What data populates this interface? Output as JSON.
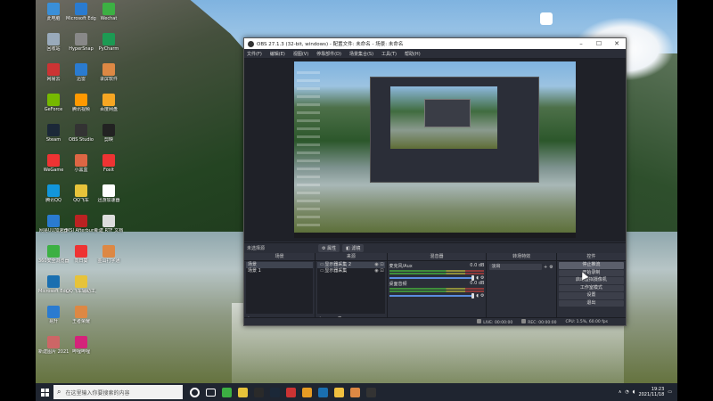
{
  "desktop_icons": [
    {
      "label": "此电脑",
      "color": "#3a8fd8",
      "col": 0,
      "row": 0
    },
    {
      "label": "Microsoft Edge",
      "color": "#2a7bd0",
      "col": 1,
      "row": 0
    },
    {
      "label": "Wechat",
      "color": "#3cb043",
      "col": 2,
      "row": 0
    },
    {
      "label": "回收站",
      "color": "#9ab",
      "col": 0,
      "row": 1
    },
    {
      "label": "HyperSnap",
      "color": "#888",
      "col": 1,
      "row": 1
    },
    {
      "label": "PyCharm",
      "color": "#1c9a53",
      "col": 2,
      "row": 1
    },
    {
      "label": "网易云",
      "color": "#c33",
      "col": 0,
      "row": 2
    },
    {
      "label": "迅雷",
      "color": "#2a7bd0",
      "col": 1,
      "row": 2
    },
    {
      "label": "录屏软件",
      "color": "#d84",
      "col": 2,
      "row": 2
    },
    {
      "label": "GeForce",
      "color": "#76b900",
      "col": 0,
      "row": 3
    },
    {
      "label": "腾讯视频",
      "color": "#f90",
      "col": 1,
      "row": 3
    },
    {
      "label": "百度网盘",
      "color": "#f6a623",
      "col": 2,
      "row": 3
    },
    {
      "label": "Steam",
      "color": "#1b2838",
      "col": 0,
      "row": 4
    },
    {
      "label": "OBS Studio",
      "color": "#333",
      "col": 1,
      "row": 4
    },
    {
      "label": "剪映",
      "color": "#222",
      "col": 2,
      "row": 4
    },
    {
      "label": "WeGame",
      "color": "#e33",
      "col": 0,
      "row": 5
    },
    {
      "label": "小黑盒",
      "color": "#d64",
      "col": 1,
      "row": 5
    },
    {
      "label": "Foxit",
      "color": "#e33",
      "col": 2,
      "row": 5
    },
    {
      "label": "腾讯QQ",
      "color": "#1296db",
      "col": 0,
      "row": 6
    },
    {
      "label": "QQ飞车",
      "color": "#e7c33a",
      "col": 1,
      "row": 6
    },
    {
      "label": "迅游加速器",
      "color": "#fff",
      "col": 2,
      "row": 6
    },
    {
      "label": "网易UU加速器",
      "color": "#2a7bd0",
      "col": 0,
      "row": 7
    },
    {
      "label": "MSI Afterburner",
      "color": "#b22",
      "col": 1,
      "row": 7
    },
    {
      "label": "新建 RTF 文档",
      "color": "#ddd",
      "col": 2,
      "row": 7
    },
    {
      "label": "360安全浏览器",
      "color": "#3cb043",
      "col": 0,
      "row": 8
    },
    {
      "label": "向日葵",
      "color": "#e33",
      "col": 1,
      "row": 8
    },
    {
      "label": "金山打字通",
      "color": "#d84",
      "col": 2,
      "row": 8
    },
    {
      "label": "Microsoft Edge",
      "color": "#1a6fb0",
      "col": 0,
      "row": 9
    },
    {
      "label": "QQ飞车辅助工具",
      "color": "#e7c33a",
      "col": 1,
      "row": 9
    },
    {
      "label": "易升",
      "color": "#2a7bd0",
      "col": 0,
      "row": 10
    },
    {
      "label": "王者荣耀",
      "color": "#d84",
      "col": 1,
      "row": 10
    },
    {
      "label": "新建图片 2021110...",
      "color": "#c66",
      "col": 0,
      "row": 11
    },
    {
      "label": "哔哩哔哩",
      "color": "#d4237a",
      "col": 1,
      "row": 11
    }
  ],
  "obs": {
    "title": "OBS 27.1.3 (32-bit, windows) - 配置文件: 未命名 - 场景: 未命名",
    "menu": [
      "文件(F)",
      "编辑(E)",
      "视图(V)",
      "停靠部件(D)",
      "场景集合(S)",
      "工具(T)",
      "帮助(H)"
    ],
    "no_source": "未选择源",
    "btn_properties": "属性",
    "btn_filters": "滤镜",
    "docks": {
      "scenes": {
        "title": "场景",
        "items": [
          "场景",
          "场景 1"
        ]
      },
      "sources": {
        "title": "来源",
        "items": [
          "显示器采集 2",
          "显示器采集"
        ]
      },
      "mixer": {
        "title": "混音器",
        "channels": [
          {
            "name": "麦克风/Aux",
            "db": "0.0 dB"
          },
          {
            "name": "桌面音频",
            "db": "0.0 dB"
          }
        ]
      },
      "transitions": {
        "title": "转场特效",
        "selected": "淡出",
        "duration_label": "时长",
        "duration": "300 ms"
      },
      "controls": {
        "title": "控件",
        "buttons": [
          "停止推流",
          "开始录制",
          "启动虚拟摄像机",
          "工作室模式",
          "设置",
          "退出"
        ]
      }
    },
    "status": {
      "live_label": "LIVE:",
      "live_time": "00:00:00",
      "rec_label": "REC:",
      "rec_time": "00:00:00",
      "cpu": "CPU: 1.5%, 60.00 fps"
    }
  },
  "taskbar": {
    "search_placeholder": "在这里输入你要搜索的内容",
    "apps": [
      {
        "name": "cortana",
        "color": "#fff"
      },
      {
        "name": "task-view",
        "color": "#fff"
      },
      {
        "name": "wechat",
        "color": "#3cb043"
      },
      {
        "name": "chrome",
        "color": "#e7c33a"
      },
      {
        "name": "adobe",
        "color": "#2a2a2a"
      },
      {
        "name": "steam",
        "color": "#1b2838"
      },
      {
        "name": "foxit",
        "color": "#c33"
      },
      {
        "name": "g-app",
        "color": "#e69c24"
      },
      {
        "name": "edge",
        "color": "#1a6fb0"
      },
      {
        "name": "folder",
        "color": "#f0c040"
      },
      {
        "name": "game",
        "color": "#d84"
      },
      {
        "name": "obs",
        "color": "#333"
      }
    ],
    "time": "19:23",
    "date": "2021/11/18"
  }
}
